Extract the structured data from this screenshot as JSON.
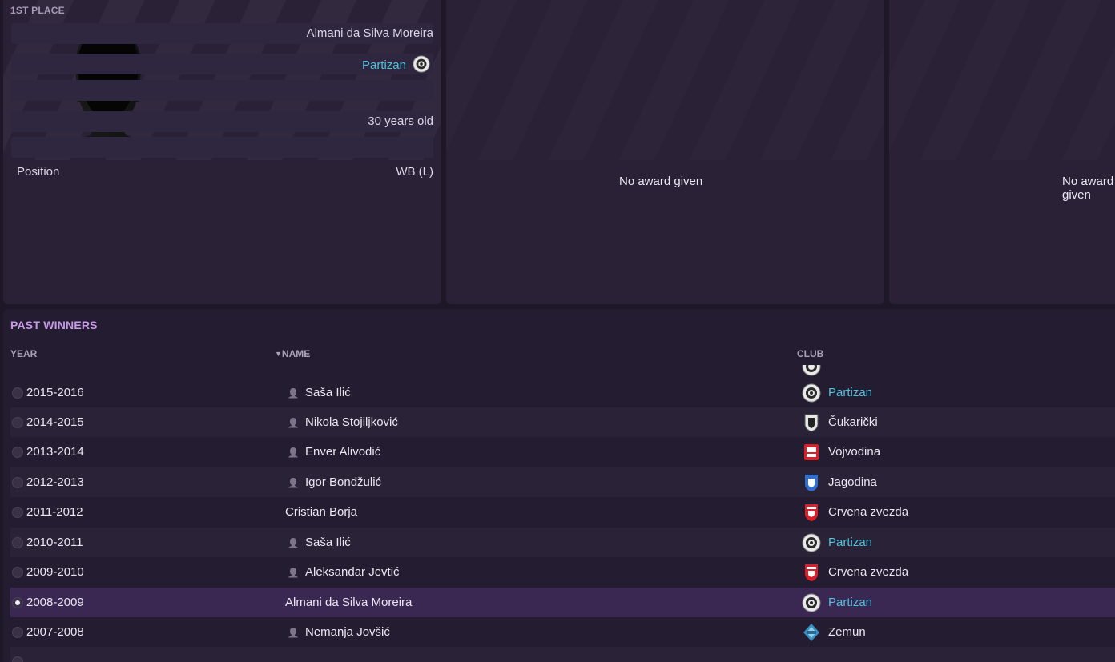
{
  "first_place": {
    "label": "1ST PLACE",
    "player_name": "Almani da Silva Moreira",
    "club": "Partizan",
    "age": "30 years old",
    "position_label": "Position",
    "position_value": "WB (L)"
  },
  "second_panel": {
    "message": "No award given"
  },
  "third_panel": {
    "message": "No award given"
  },
  "past_winners": {
    "title": "PAST WINNERS",
    "columns": {
      "year": "YEAR",
      "name": "NAME",
      "club": "CLUB"
    },
    "rows": [
      {
        "year": "2015-2016",
        "name": "Saša Ilić",
        "club": "Partizan"
      },
      {
        "year": "2014-2015",
        "name": "Nikola Stojiljković",
        "club": "Čukarički"
      },
      {
        "year": "2013-2014",
        "name": "Enver Alivodić",
        "club": "Vojvodina"
      },
      {
        "year": "2012-2013",
        "name": "Igor Bondžulić",
        "club": "Jagodina"
      },
      {
        "year": "2011-2012",
        "name": "Cristian Borja",
        "club": "Crvena zvezda"
      },
      {
        "year": "2010-2011",
        "name": "Saša Ilić",
        "club": "Partizan"
      },
      {
        "year": "2009-2010",
        "name": "Aleksandar Jevtić",
        "club": "Crvena zvezda"
      },
      {
        "year": "2008-2009",
        "name": "Almani da Silva Moreira",
        "club": "Partizan"
      },
      {
        "year": "2007-2008",
        "name": "Nemanja Jovšić",
        "club": "Zemun"
      }
    ]
  },
  "colors": {
    "accent_link": "#4fc3dd",
    "section_title": "#c89ae8",
    "selected_row": "#3a2752"
  }
}
